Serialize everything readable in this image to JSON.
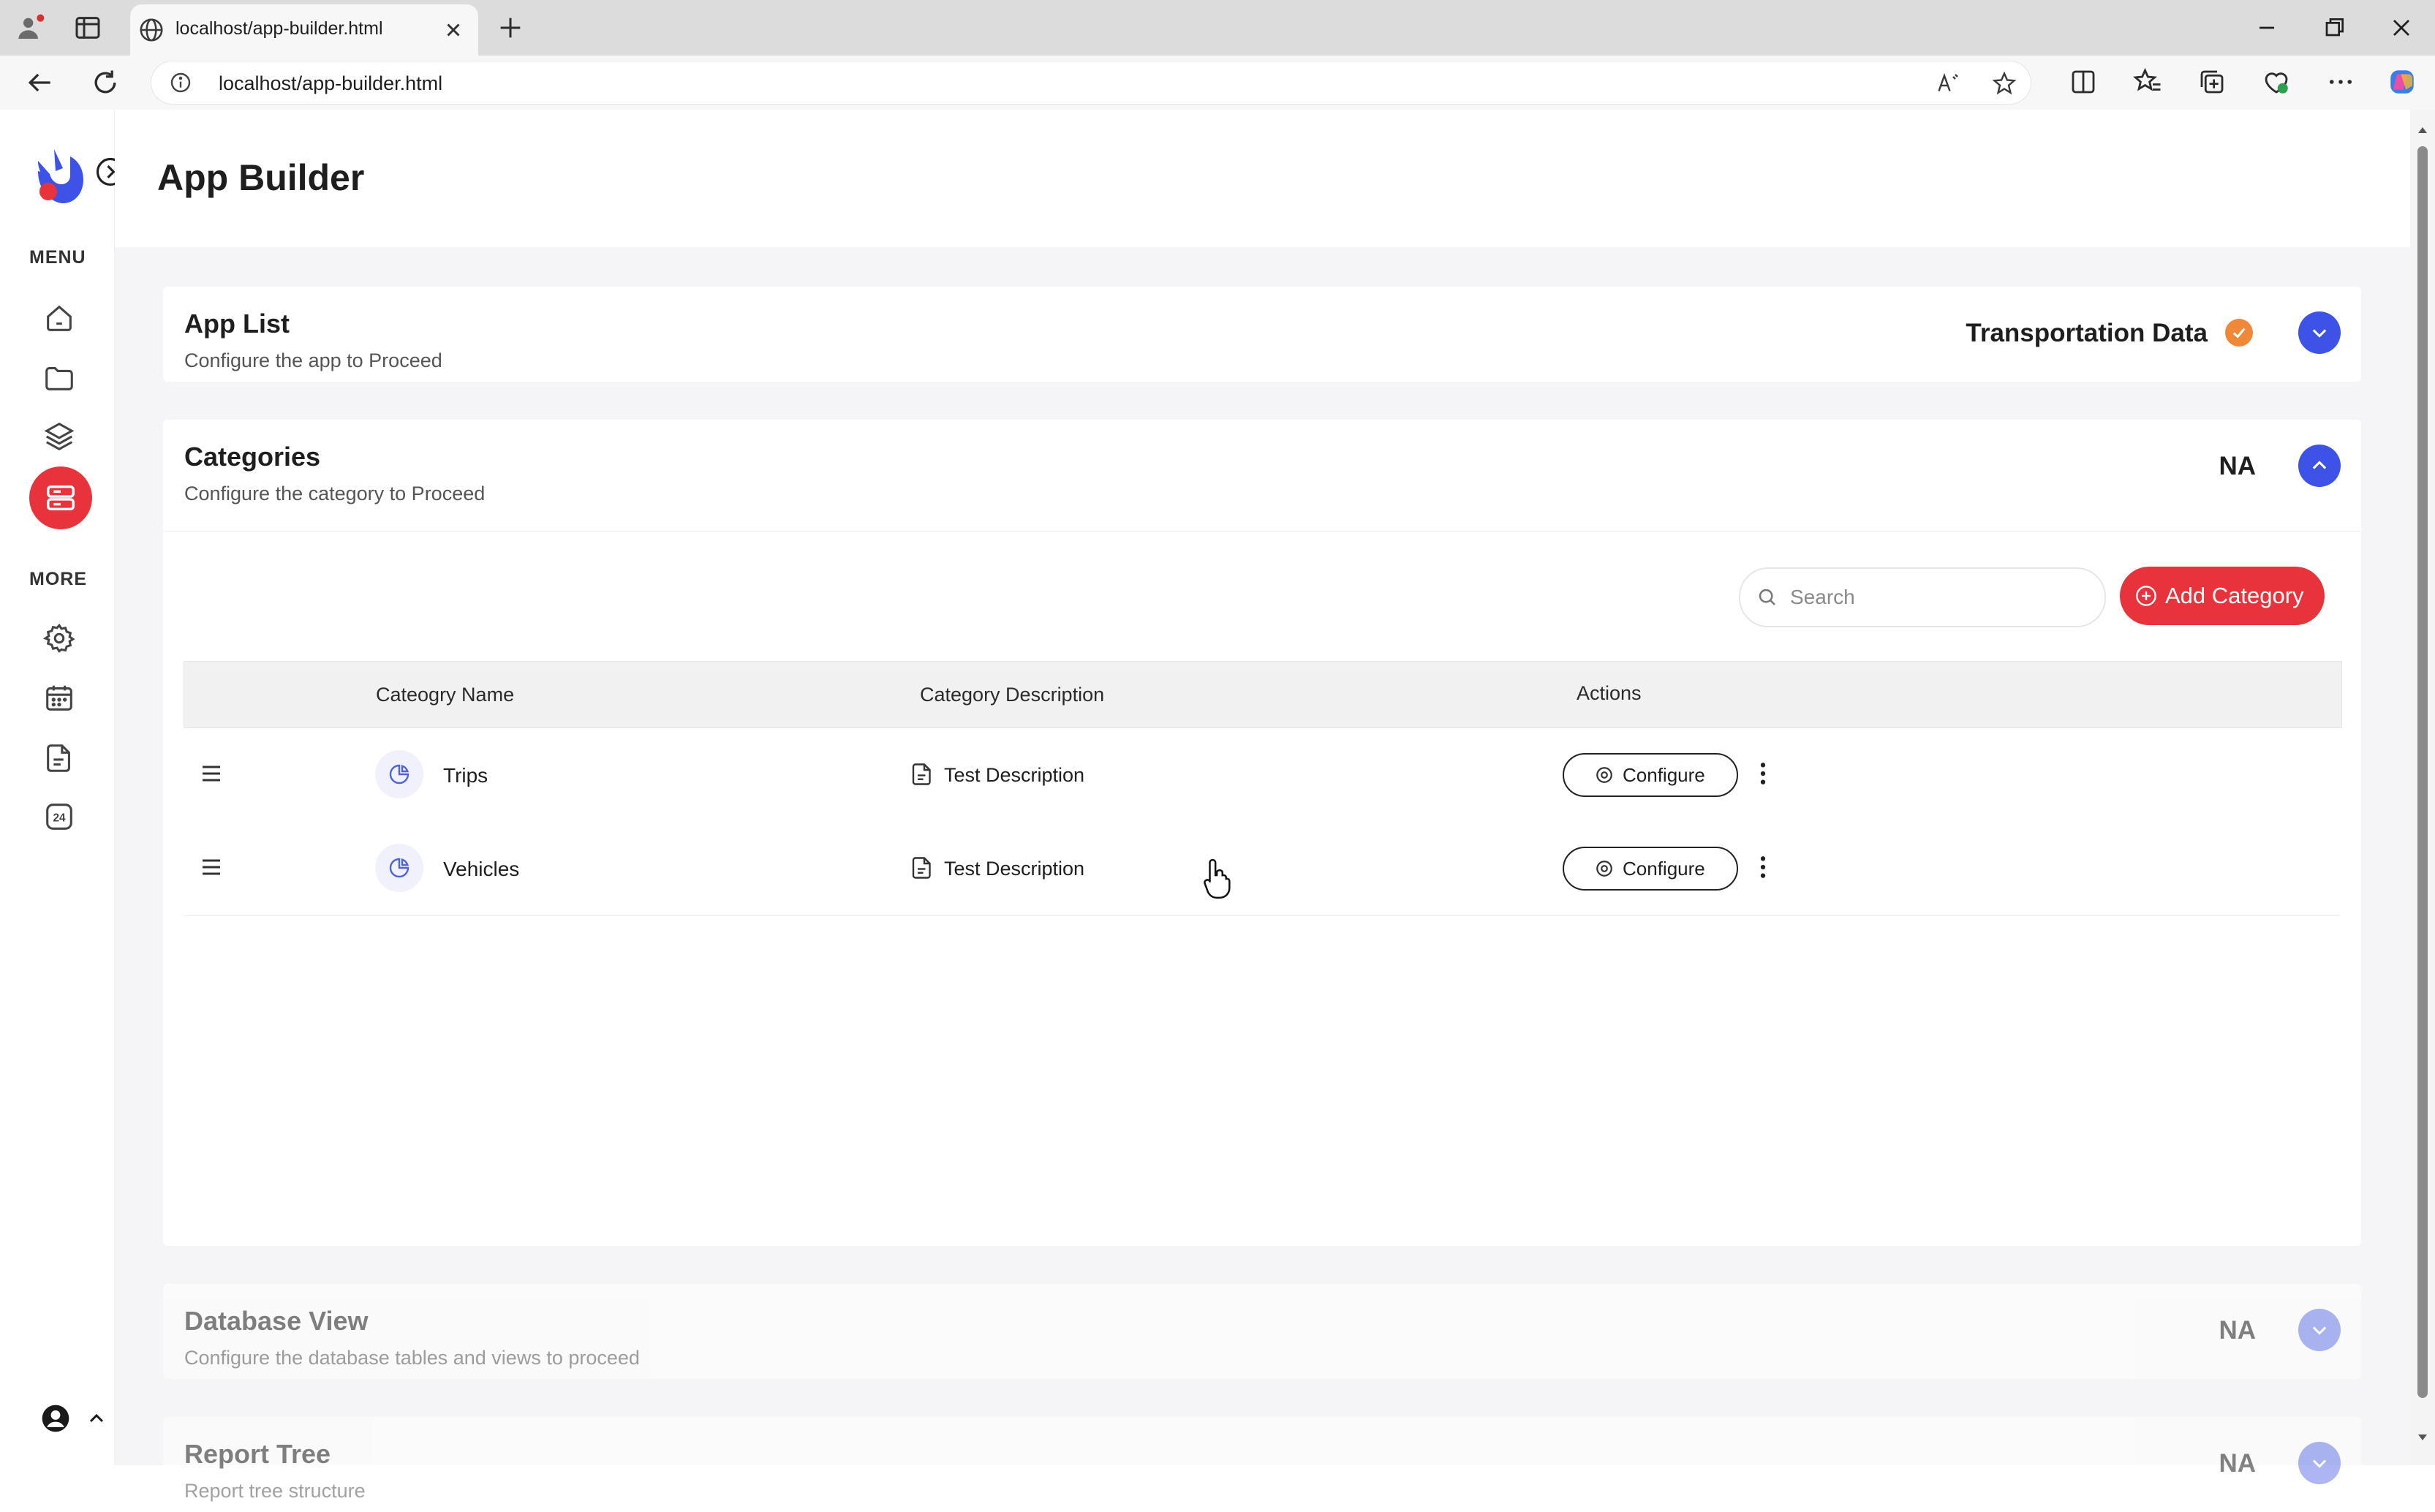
{
  "browser": {
    "tab_title": "localhost/app-builder.html",
    "url": "localhost/app-builder.html"
  },
  "sidebar": {
    "menu_label": "MENU",
    "more_label": "MORE",
    "items": [
      {
        "icon": "home-icon"
      },
      {
        "icon": "folder-icon"
      },
      {
        "icon": "layers-icon"
      },
      {
        "icon": "server-icon",
        "active": true
      }
    ],
    "more_items": [
      {
        "icon": "gear-icon"
      },
      {
        "icon": "calendar-icon"
      },
      {
        "icon": "document-icon"
      },
      {
        "icon": "24-hour-icon"
      }
    ],
    "accent_color": "#e8333d"
  },
  "page": {
    "title": "App Builder"
  },
  "panels": {
    "app_list": {
      "title": "App List",
      "subtitle": "Configure the app to Proceed",
      "status": "Transportation Data",
      "status_badge": "check-icon",
      "expanded": false
    },
    "categories": {
      "title": "Categories",
      "subtitle": "Configure the category to Proceed",
      "status": "NA",
      "expanded": true,
      "search_placeholder": "Search",
      "add_button_label": "Add Category",
      "table": {
        "columns": [
          "Cateogry Name",
          "Category Description",
          "Actions"
        ],
        "rows": [
          {
            "name": "Trips",
            "description": "Test Description",
            "action": "Configure"
          },
          {
            "name": "Vehicles",
            "description": "Test Description",
            "action": "Configure"
          }
        ]
      }
    },
    "database_view": {
      "title": "Database View",
      "subtitle": "Configure the database tables and views to proceed",
      "status": "NA",
      "expanded": false
    },
    "report_tree": {
      "title": "Report Tree",
      "subtitle": "Report tree structure",
      "status": "NA",
      "expanded": false
    }
  },
  "colors": {
    "primary_blue": "#3d52e6",
    "danger_red": "#e8333d",
    "success_orange": "#f0883a"
  }
}
